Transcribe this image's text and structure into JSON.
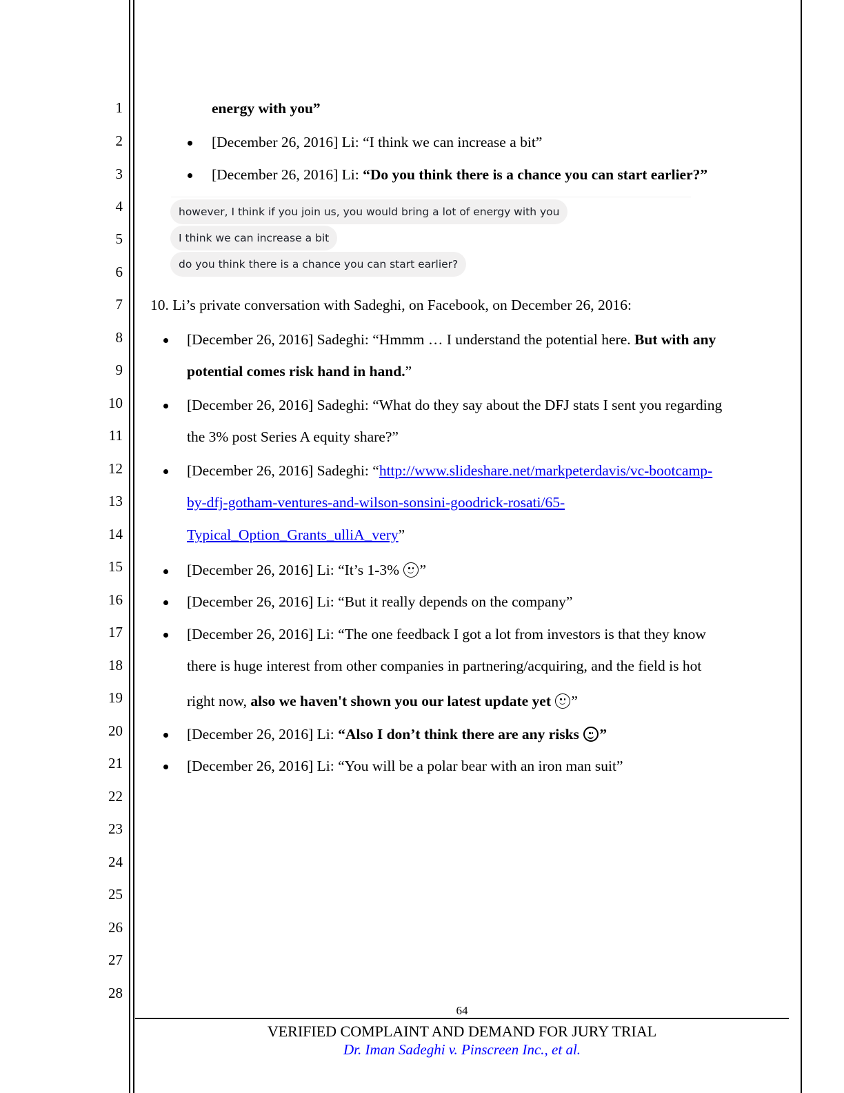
{
  "line_numbers": [
    "1",
    "2",
    "3",
    "4",
    "5",
    "6",
    "7",
    "8",
    "9",
    "10",
    "11",
    "12",
    "13",
    "14",
    "15",
    "16",
    "17",
    "18",
    "19",
    "20",
    "21",
    "22",
    "23",
    "24",
    "25",
    "26",
    "27",
    "28"
  ],
  "top_section": {
    "continuation": "energy with you”",
    "bullets": [
      {
        "prefix": "[December 26, 2016] Li: ",
        "quote": "“I think we can increase a bit”"
      },
      {
        "prefix": "[December 26, 2016] Li: ",
        "quote": "“Do you think there is a chance you can start earlier?”"
      }
    ]
  },
  "chat_screenshot": {
    "messages": [
      "however, I think if you join us, you would bring a lot of energy with you",
      "I think we can increase a bit",
      "do you think there is a chance you can start earlier?"
    ]
  },
  "section_10": {
    "heading": "10. Li’s private conversation with Sadeghi, on Facebook, on December 26, 2016:",
    "b1": {
      "prefix": "[December 26, 2016] Sadeghi: “Hmmm … I understand the potential here. ",
      "bold1": "But with any",
      "bold2": "potential comes risk hand in hand.",
      "end": "”"
    },
    "b2": {
      "line1": "[December 26, 2016] Sadeghi: “What do they say about the DFJ stats I sent you regarding",
      "line2": "the 3% post Series A equity share?”"
    },
    "b3": {
      "prefix": "[December 26, 2016] Sadeghi: “",
      "link1": "http://www.slideshare.net/markpeterdavis/vc-bootcamp-",
      "link2": "by-dfj-gotham-ventures-and-wilson-sonsini-goodrick-rosati/65-",
      "link3": "Typical_Option_Grants_ulliA_very",
      "end": "”"
    },
    "b4": {
      "text": "[December 26, 2016] Li: “It’s 1-3% ",
      "icon": "smiley-icon",
      "end": "”"
    },
    "b5": {
      "text": "[December 26, 2016] Li: “But it really depends on the company”"
    },
    "b6": {
      "line1": "[December 26, 2016] Li: “The one feedback I got a lot from investors is that they know",
      "line2": "there is huge interest from other companies in partnering/acquiring, and the field is hot",
      "line3_plain": "right now, ",
      "line3_bold": "also we haven't shown you our latest update yet ",
      "icon": "smiley-icon",
      "end": "”"
    },
    "b7": {
      "prefix": "[December 26, 2016] Li: ",
      "bold": "“Also I don’t think there are any risks ",
      "icon": "smiley-icon",
      "end": "”"
    },
    "b8": {
      "text": "[December 26, 2016] Li: “You will be a polar bear with an iron man suit”"
    }
  },
  "footer": {
    "page_number": "64",
    "title": "VERIFIED COMPLAINT AND DEMAND FOR JURY TRIAL",
    "case_name": "Dr. Iman Sadeghi v. Pinscreen Inc., et al."
  },
  "colors": {
    "link": "#0000ee",
    "case_name": "#0000ff",
    "chat_bubble": "#f1f0f0"
  }
}
